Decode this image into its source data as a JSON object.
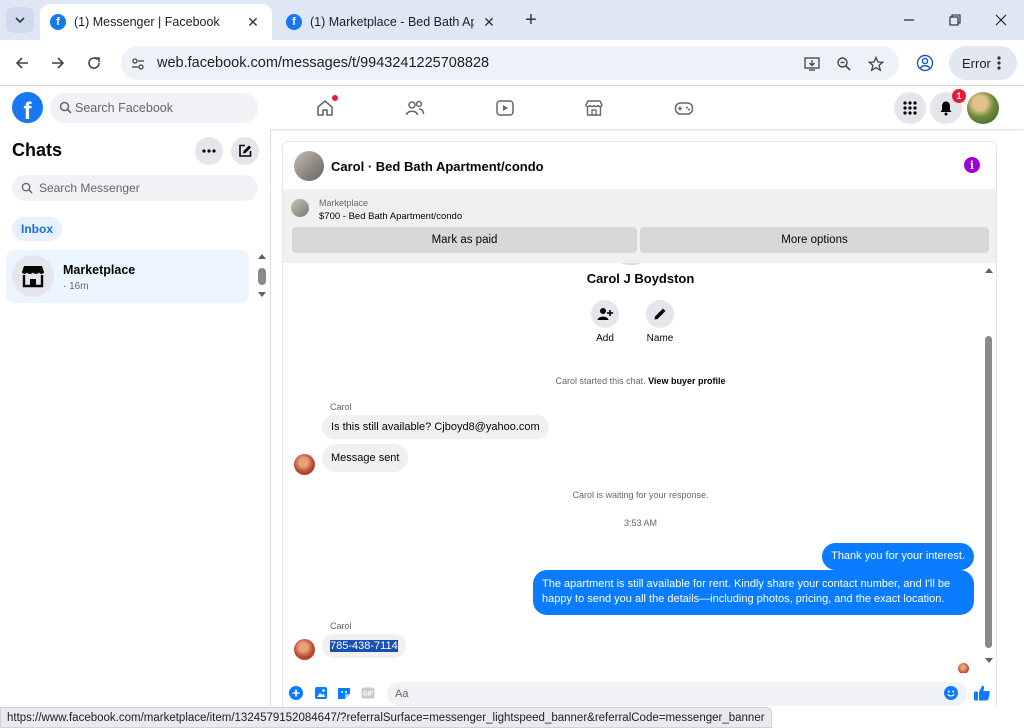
{
  "browser": {
    "tabs": [
      {
        "title": "(1) Messenger | Facebook",
        "active": true
      },
      {
        "title": "(1) Marketplace - Bed Bath Apartment/condo",
        "active": false
      }
    ],
    "url": "web.facebook.com/messages/t/9943241225708828",
    "profile_button": "Error",
    "status_url": "https://www.facebook.com/marketplace/item/1324579152084647/?referralSurface=messenger_lightspeed_banner&referralCode=messenger_banner"
  },
  "fb": {
    "search_placeholder": "Search Facebook",
    "notifications_count": "1",
    "logo_letter": "f"
  },
  "sidebar": {
    "title": "Chats",
    "search_placeholder": "Search Messenger",
    "filter_chip": "Inbox",
    "chats": [
      {
        "name": "Marketplace",
        "time": "· 16m"
      }
    ]
  },
  "conversation": {
    "title": "Carol · Bed Bath Apartment/condo",
    "banner": {
      "label": "Marketplace",
      "listing": "$700 - Bed Bath Apartment/condo",
      "mark_paid": "Mark as paid",
      "more_options": "More options"
    },
    "profile_name": "Carol J Boydston",
    "actions": {
      "add": "Add",
      "name": "Name"
    },
    "started_text": "Carol started this chat. ",
    "view_buyer_profile": "View buyer profile",
    "sender_name": "Carol",
    "msg1": "Is this still available?  Cjboyd8@yahoo.com",
    "msg2": "Message sent",
    "waiting_text": "Carol is waiting for your response.",
    "timestamp": "3:53 AM",
    "out1": "Thank you for your interest.",
    "out2": "The apartment is still available for rent. Kindly share your contact number, and I'll be happy to send you all the details—including photos, pricing, and the exact location.",
    "sender_name_2": "Carol",
    "msg3": "785-438-7114",
    "composer_placeholder": "Aa"
  },
  "colors": {
    "fb_blue": "#1877f2",
    "outgoing_bubble": "#0a7cff",
    "info_purple": "#a000d6",
    "badge_red": "#e41e3f"
  }
}
